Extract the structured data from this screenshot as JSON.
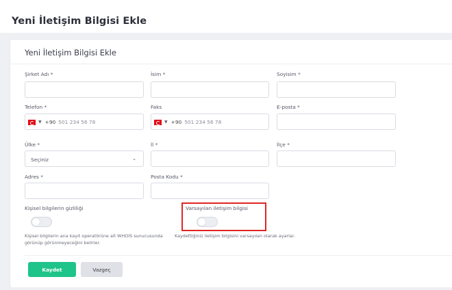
{
  "header": {
    "title": "Yeni İletişim Bilgisi Ekle"
  },
  "card": {
    "title": "Yeni İletişim Bilgisi Ekle"
  },
  "fields": {
    "company_label": "Şirket Adı *",
    "name_label": "İsim *",
    "surname_label": "Soyisim *",
    "phone_label": "Telefon *",
    "phone_code": "+90",
    "phone_placeholder": "501 234 56 78",
    "fax_label": "Faks",
    "fax_code": "+90",
    "fax_placeholder": "501 234 56 78",
    "email_label": "E-posta *",
    "country_label": "Ülke *",
    "country_value": "Seçiniz",
    "city_label": "İl *",
    "district_label": "İlçe *",
    "address_label": "Adres *",
    "postal_label": "Posta Kodu *"
  },
  "privacy": {
    "label": "Kişisel bilgilerin gizliliği",
    "help_line1": "Kişisel bilgilerin ana kayıt operatörüne ait WHOIS sunucusunda",
    "help_line2": "görünüp görünmeyeceğini belirler.",
    "enabled": false
  },
  "default_contact": {
    "label": "Varsayılan iletişim bilgisi",
    "help": "Kaydettiğiniz iletişim bilgisini varsayılan olarak ayarlar.",
    "enabled": false
  },
  "actions": {
    "save": "Kaydet",
    "cancel": "Vazgeç"
  },
  "colors": {
    "primary": "#1fc48a",
    "highlight": "#e02424",
    "flag": "#e30a17"
  }
}
